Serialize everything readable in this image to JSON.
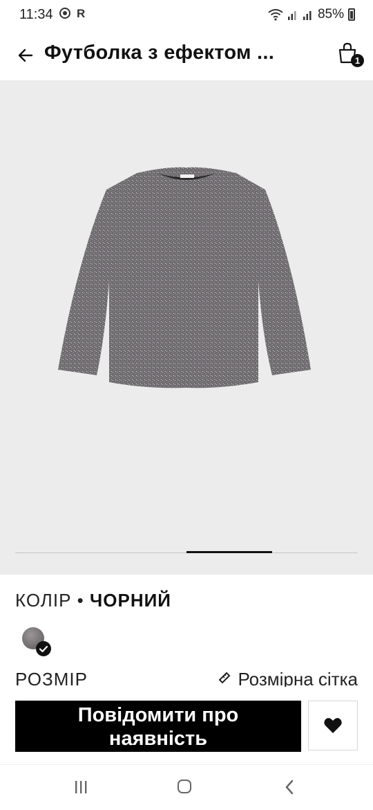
{
  "status_bar": {
    "time": "11:34",
    "carrier_letter": "R",
    "battery": "85%",
    "icons": [
      "wifi-icon",
      "signal-icon",
      "signal-icon",
      "battery-icon"
    ]
  },
  "header": {
    "title": "Футболка з ефектом ...",
    "cart_count": "1",
    "icons": [
      "arrow-left-icon",
      "shopping-bag-icon"
    ]
  },
  "gallery": {
    "image_alt": "product-tshirt-image",
    "current_index": 3,
    "total": 4
  },
  "product": {
    "color_label": "КОЛІР",
    "color_separator": " • ",
    "color_value": "ЧОРНИЙ",
    "swatch_color": "#78737a",
    "size_label": "РОЗМІР",
    "size_guide_label": "Розмірна сітка"
  },
  "actions": {
    "notify_line1": "Повідомити про",
    "notify_line2": "наявність",
    "wishlist_icon": "heart-icon"
  },
  "nav": {
    "icons": [
      "recent-apps-icon",
      "home-icon",
      "back-icon"
    ]
  }
}
